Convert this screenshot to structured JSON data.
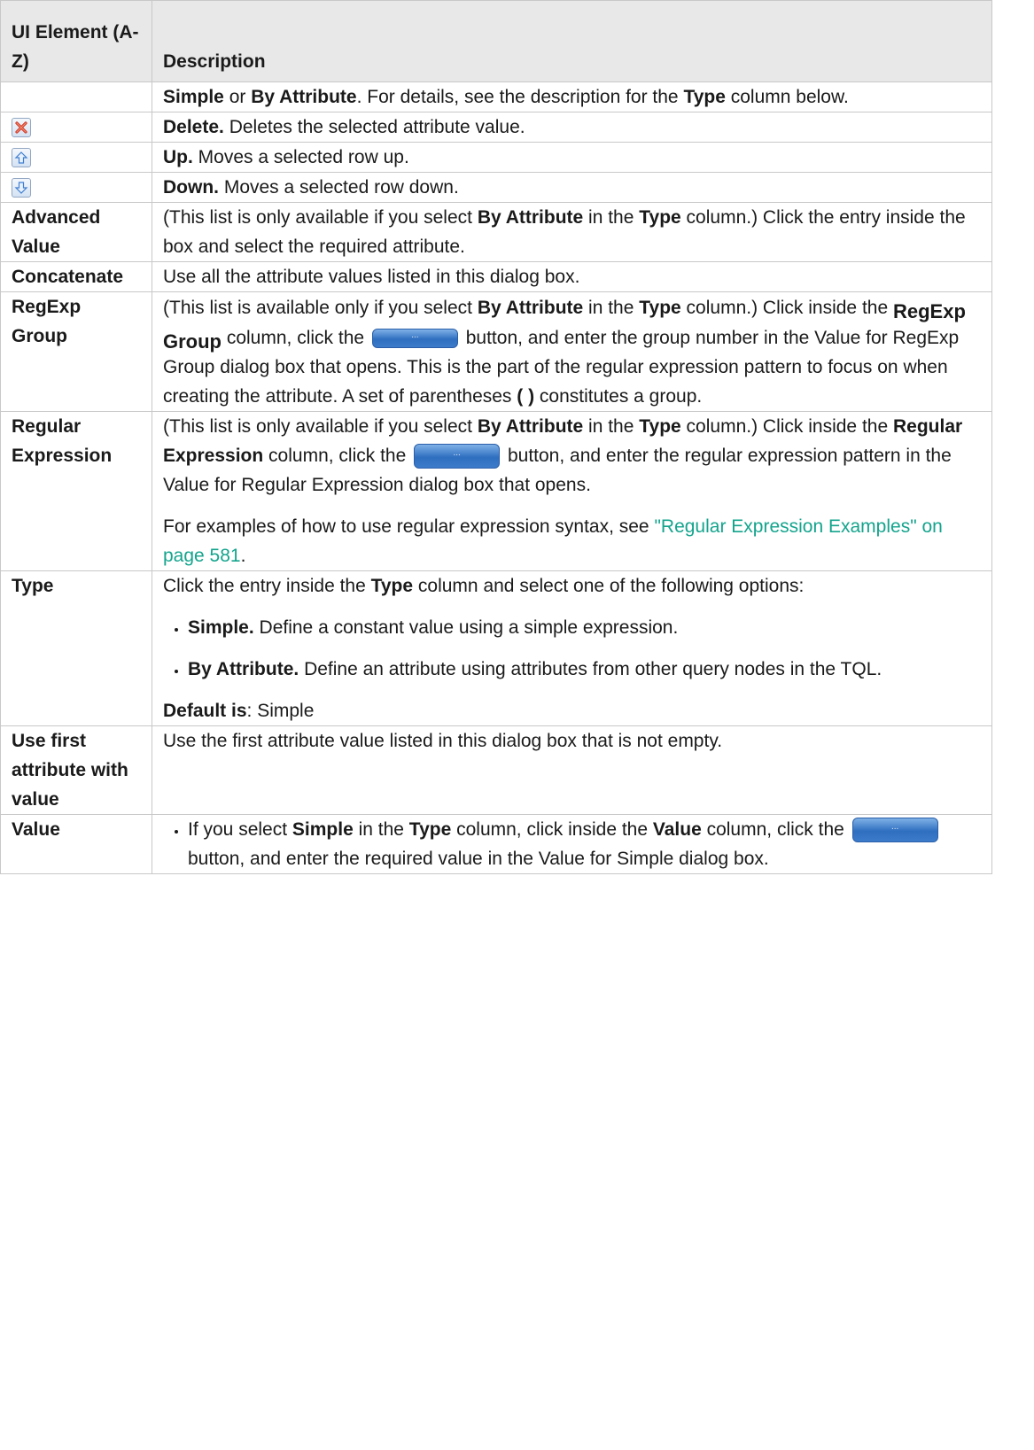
{
  "header": {
    "col1": "UI Element (A-Z)",
    "col2": "Description"
  },
  "colors": {
    "link": "#14a48d",
    "header_bg": "#e8e8e8",
    "border": "#c8c8c8"
  },
  "rows": {
    "r0": {
      "simple": "Simple",
      "or": " or ",
      "by_attr": "By Attribute",
      "rest1": ". For details, see the description for the ",
      "type": "Type",
      "rest2": " column below."
    },
    "delete": {
      "icon": "delete-x-icon",
      "label": "Delete.",
      "text": " Deletes the selected attribute value."
    },
    "up": {
      "icon": "arrow-up-icon",
      "label": "Up.",
      "text": " Moves a selected row up."
    },
    "down": {
      "icon": "arrow-down-icon",
      "label": "Down.",
      "text": " Moves a selected row down."
    },
    "advanced": {
      "element": "Advanced Value",
      "t1": "(This list is only available if you select ",
      "by_attr": "By Attribute",
      "t2": " in the ",
      "type": "Type",
      "t3": " column.) Click the entry inside the box and select the required attribute."
    },
    "concatenate": {
      "element": "Concatenate",
      "text": "Use all the attribute values listed in this dialog box."
    },
    "regexp_group": {
      "element": "RegExp Group",
      "t1": "(This list is available only if you select ",
      "by_attr": "By Attribute",
      "t2": " in the ",
      "type": "Type",
      "t3": " column.) Click inside the ",
      "col_name": "RegExp Group",
      "t4": " column, click the ",
      "button_text": "...",
      "t5": " button, and enter the group number in the Value for RegExp Group dialog box that opens. This is the part of the regular expression pattern to focus on when creating the attribute. A set of parentheses ",
      "parens": "( )",
      "t6": " constitutes a group."
    },
    "regular_expression": {
      "element": "Regular Expression",
      "t1": "(This list is only available if you select ",
      "by_attr": "By Attribute",
      "t2": " in the ",
      "type": "Type",
      "t3": " column.) Click inside the ",
      "col_name": "Regular Expression",
      "t4": " column, click the ",
      "button_text": "...",
      "t5": " button, and enter the regular expression pattern in the Value for Regular Expression dialog box that opens.",
      "p2_text": "For examples of how to use regular expression syntax, see ",
      "p2_link": "\"Regular Expression Examples\" on page 581",
      "p2_end": "."
    },
    "type": {
      "element": "Type",
      "t1": "Click the entry inside the ",
      "type": "Type",
      "t2": " column and select one of the following options:",
      "opt1_label": "Simple.",
      "opt1_text": " Define a constant value using a simple expression.",
      "opt2_label": "By Attribute.",
      "opt2_text": " Define an attribute using attributes from other query nodes in the TQL.",
      "default_label": "Default is",
      "default_text": ": Simple"
    },
    "use_first": {
      "element": "Use first attribute with value",
      "text": "Use the first attribute value listed in this dialog box that is not empty."
    },
    "value": {
      "element": "Value",
      "t1": "If you select ",
      "simple": "Simple",
      "t2": " in the ",
      "type": "Type",
      "t3": " column, click inside the ",
      "value": "Value",
      "t4": " column, click the ",
      "button_text": "...",
      "t5": " button, and enter the required value in the Value for Simple dialog box."
    }
  }
}
